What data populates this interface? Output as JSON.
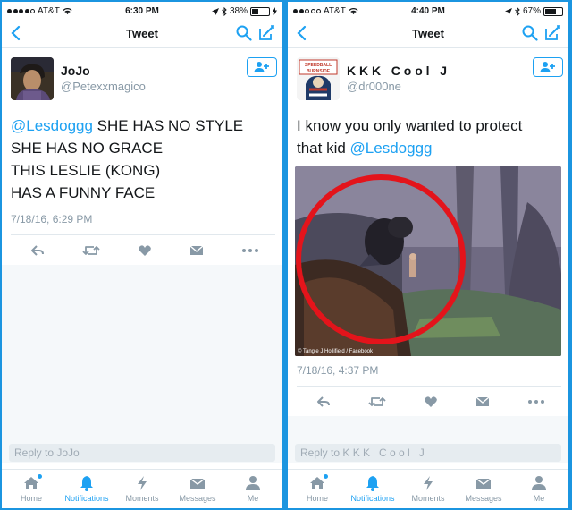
{
  "left": {
    "status": {
      "carrier": "AT&T",
      "time": "6:30 PM",
      "battery": "38%",
      "battery_fraction": 0.38
    },
    "nav": {
      "title": "Tweet"
    },
    "tweet": {
      "display_name": "JoJo",
      "handle": "@Petexxmagico",
      "mention": "@Lesdoggg",
      "line1_rest": " SHE HAS NO STYLE",
      "line2": "SHE HAS NO GRACE",
      "line3": "THIS LESLIE (KONG)",
      "line4": "HAS A FUNNY FACE",
      "timestamp": "7/18/16, 6:29 PM"
    },
    "reply_placeholder": "Reply to JoJo"
  },
  "right": {
    "status": {
      "carrier": "AT&T",
      "time": "4:40 PM",
      "battery": "67%",
      "battery_fraction": 0.67
    },
    "nav": {
      "title": "Tweet"
    },
    "tweet": {
      "display_name": "K K K   C o o l   J",
      "handle": "@dr000ne",
      "avatar_text": "SPEEDBALL BURNSIDE",
      "line1": "I know you only wanted to protect",
      "line2_prefix": "that kid ",
      "mention": "@Lesdoggg",
      "photo_credit": "© Tangle J Hollifield / Facebook",
      "timestamp": "7/18/16, 4:37 PM"
    },
    "reply_placeholder": "Reply to K K K   C o o l   J"
  },
  "tabs": [
    {
      "label": "Home",
      "icon": "home-icon"
    },
    {
      "label": "Notifications",
      "icon": "bell-icon"
    },
    {
      "label": "Moments",
      "icon": "lightning-icon"
    },
    {
      "label": "Messages",
      "icon": "envelope-icon"
    },
    {
      "label": "Me",
      "icon": "person-icon"
    }
  ],
  "colors": {
    "accent": "#1da1f2",
    "frame": "#1b95e0",
    "muted": "#8899a6"
  }
}
